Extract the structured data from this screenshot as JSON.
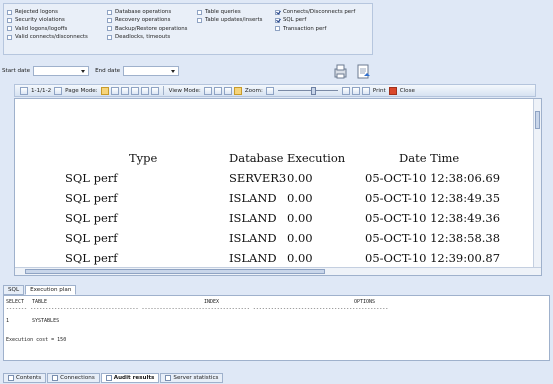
{
  "filters": {
    "col1": [
      {
        "label": "Rejected logons",
        "checked": false
      },
      {
        "label": "Security violations",
        "checked": false
      },
      {
        "label": "Valid logons/logoffs",
        "checked": false
      },
      {
        "label": "Valid connects/disconnects",
        "checked": false
      }
    ],
    "col2": [
      {
        "label": "Database operations",
        "checked": false
      },
      {
        "label": "Recovery operations",
        "checked": false
      },
      {
        "label": "Backup/Restore operations",
        "checked": false
      },
      {
        "label": "Deadlocks, timeouts",
        "checked": false
      }
    ],
    "col3": [
      {
        "label": "Table queries",
        "checked": false
      },
      {
        "label": "Table updates/inserts",
        "checked": false
      }
    ],
    "col4": [
      {
        "label": "Connects/Disconnects perf",
        "checked": true
      },
      {
        "label": "SQL perf",
        "checked": true
      },
      {
        "label": "Transaction perf",
        "checked": false
      }
    ]
  },
  "dates": {
    "start_label": "Start date",
    "end_label": "End date",
    "start_value": "",
    "end_value": ""
  },
  "toolbar": {
    "page_indicator": "1-1/1-2",
    "page_mode_label": "Page Mode:",
    "view_mode_label": "View Mode:",
    "zoom_label": "Zoom:",
    "print_label": "Print",
    "close_label": "Close"
  },
  "report": {
    "headers": {
      "type": "Type",
      "database": "Database",
      "execution": "Execution",
      "datetime": "Date Time"
    },
    "rows": [
      {
        "type": "SQL perf",
        "database": "SERVER3",
        "execution": "0.00",
        "datetime": "05-OCT-10 12:38:06.69"
      },
      {
        "type": "SQL perf",
        "database": "ISLAND",
        "execution": "0.00",
        "datetime": "05-OCT-10 12:38:49.35"
      },
      {
        "type": "SQL perf",
        "database": "ISLAND",
        "execution": "0.00",
        "datetime": "05-OCT-10 12:38:49.36"
      },
      {
        "type": "SQL perf",
        "database": "ISLAND",
        "execution": "0.00",
        "datetime": "05-OCT-10 12:38:58.38"
      },
      {
        "type": "SQL perf",
        "database": "ISLAND",
        "execution": "0.00",
        "datetime": "05-OCT-10 12:39:00.87"
      }
    ]
  },
  "bottom_tabs": [
    "SQL",
    "Execution plan"
  ],
  "plan": {
    "columns": [
      "SELECT",
      "TABLE",
      "INDEX",
      "OPTIONS"
    ],
    "rule": "------- ------------------------------------ ------------------------------------ ---------------------------------------------",
    "row": {
      "select": "1",
      "table": "SYSTABLES"
    },
    "cost": "Execution cost = 150"
  },
  "doc_tabs": [
    "Contents",
    "Connections",
    "Audit results",
    "Server statistics"
  ]
}
